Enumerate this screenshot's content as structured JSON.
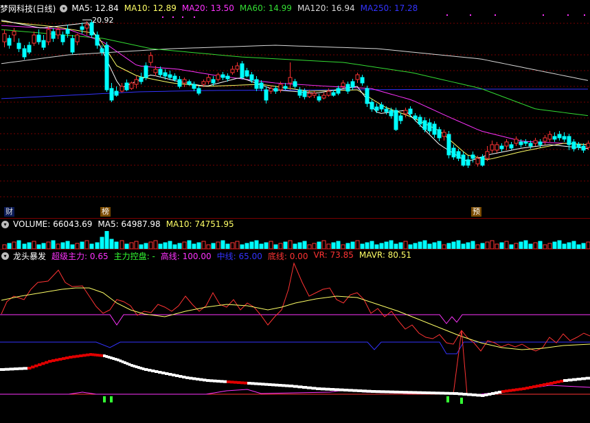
{
  "main_panel": {
    "stock_name": "梦网科技(日线)",
    "ma_labels": [
      {
        "text": "MA5: 12.84",
        "color": "#ffffff"
      },
      {
        "text": "MA10: 12.89",
        "color": "#ffff66"
      },
      {
        "text": "MA20: 13.50",
        "color": "#ff33ff"
      },
      {
        "text": "MA60: 14.99",
        "color": "#33dd33"
      },
      {
        "text": "MA120: 16.94",
        "color": "#d8d8d8"
      },
      {
        "text": "MA250: 17.28",
        "color": "#3333ff"
      }
    ],
    "peak_label": "20.92",
    "event_tags": [
      "财",
      "榜",
      "预"
    ]
  },
  "volume_panel": {
    "labels": [
      {
        "text": "VOLUME: 66043.69",
        "color": "#ffffff"
      },
      {
        "text": "MA5: 64987.98",
        "color": "#ffffff"
      },
      {
        "text": "MA10: 74751.95",
        "color": "#ffff66"
      }
    ]
  },
  "indicator_panel": {
    "name": "龙头暴发",
    "labels": [
      {
        "text": "超级主力: 0.65",
        "color": "#ff33ff"
      },
      {
        "text": "主力控盘: -",
        "color": "#33ff33"
      },
      {
        "text": "高线: 100.00",
        "color": "#ff33ff"
      },
      {
        "text": "中线: 65.00",
        "color": "#3333ff"
      },
      {
        "text": "底线: 0.00",
        "color": "#ff3333"
      },
      {
        "text": "VR: 73.85",
        "color": "#ff3333"
      },
      {
        "text": "MAVR: 80.51",
        "color": "#ffff66"
      }
    ]
  },
  "colors": {
    "up": "#ff3333",
    "down": "#00ffff",
    "grid": "#7a0000",
    "background": "#000000"
  }
}
